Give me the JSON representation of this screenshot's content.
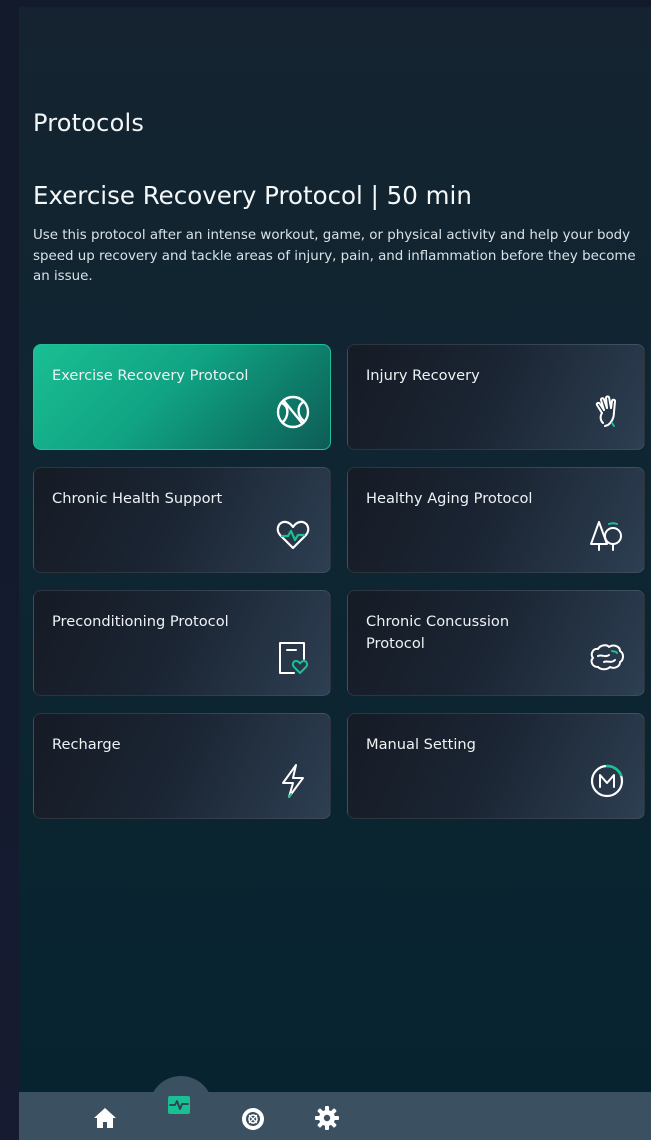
{
  "header": {
    "title": "Protocols"
  },
  "selected_protocol": {
    "title": "Exercise Recovery Protocol | 50 min",
    "description": "Use this protocol after an intense workout, game, or physical activity and help your body speed up recovery and tackle areas of injury, pain, and inflammation before they become an issue."
  },
  "protocols": [
    {
      "label": "Exercise Recovery Protocol",
      "icon": "sports-ball-icon",
      "selected": true
    },
    {
      "label": "Injury Recovery",
      "icon": "hand-icon",
      "selected": false
    },
    {
      "label": "Chronic Health Support",
      "icon": "heart-pulse-icon",
      "selected": false
    },
    {
      "label": "Healthy Aging Protocol",
      "icon": "trees-icon",
      "selected": false
    },
    {
      "label": "Preconditioning Protocol",
      "icon": "clipboard-heart-icon",
      "selected": false
    },
    {
      "label": "Chronic Concussion Protocol",
      "icon": "brain-icon",
      "selected": false
    },
    {
      "label": "Recharge",
      "icon": "lightning-icon",
      "selected": false
    },
    {
      "label": "Manual Setting",
      "icon": "manual-m-icon",
      "selected": false
    }
  ],
  "bottom_nav": [
    {
      "name": "home",
      "icon": "home-icon",
      "active": false
    },
    {
      "name": "protocols",
      "icon": "pulse-monitor-icon",
      "active": true
    },
    {
      "name": "device",
      "icon": "device-icon",
      "active": false
    },
    {
      "name": "settings",
      "icon": "gear-icon",
      "active": false
    }
  ],
  "colors": {
    "accent": "#1abf93",
    "background": "#0f2632",
    "nav_bar": "#3b5060"
  }
}
